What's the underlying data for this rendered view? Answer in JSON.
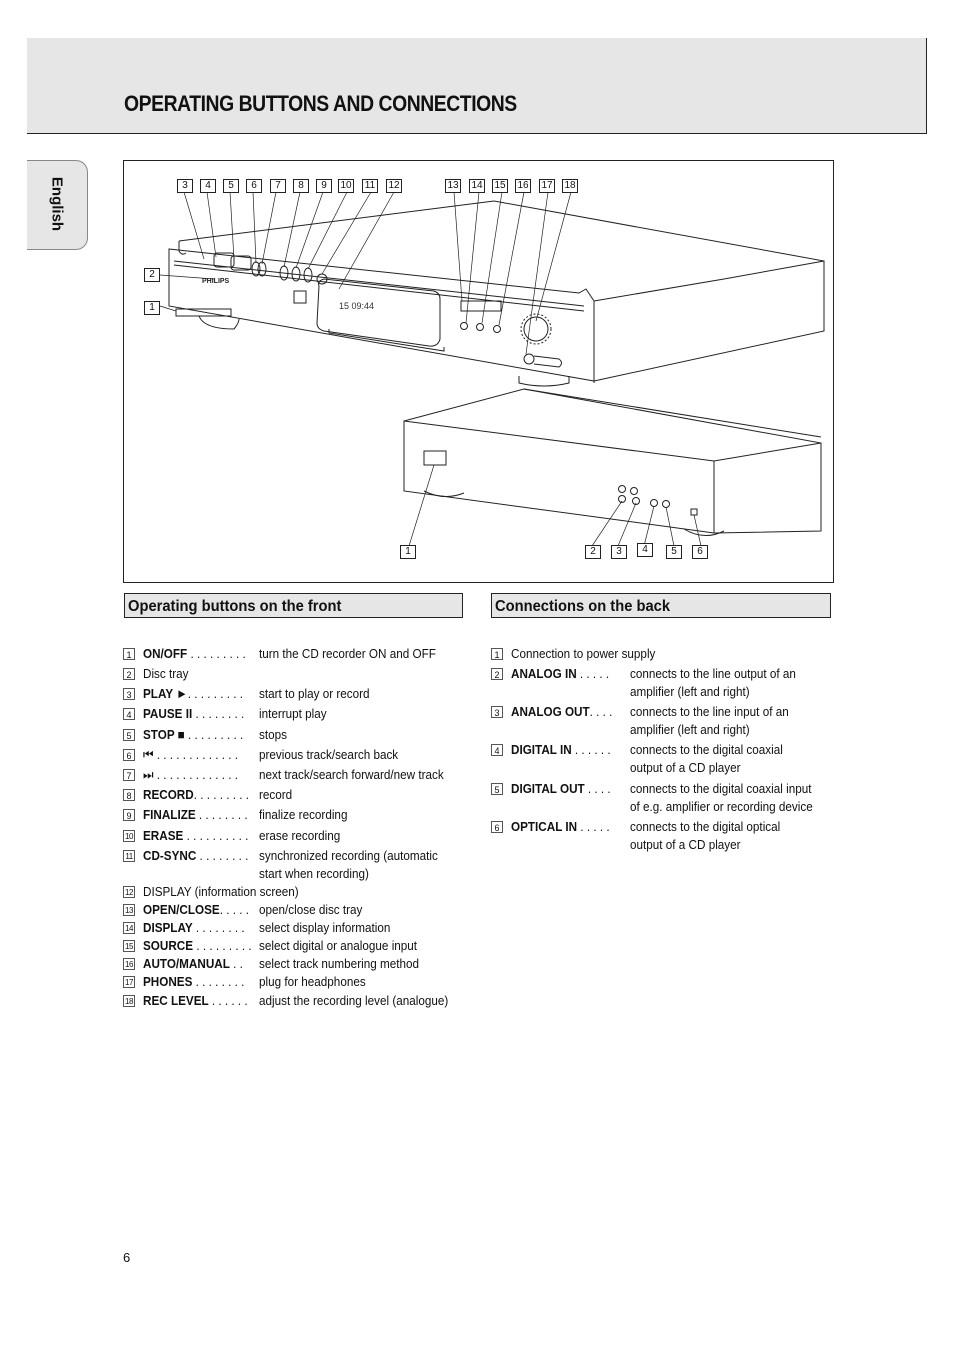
{
  "page": {
    "title": "OPERATING BUTTONS AND CONNECTIONS",
    "language_tab": "English",
    "page_number": "6"
  },
  "figure": {
    "brand": "PHILIPS",
    "display_readout": "15  09:44",
    "front_callouts": [
      "1",
      "2",
      "3",
      "4",
      "5",
      "6",
      "7",
      "8",
      "9",
      "10",
      "11",
      "12",
      "13",
      "14",
      "15",
      "16",
      "17",
      "18"
    ],
    "back_callouts": [
      "1",
      "2",
      "3",
      "4",
      "5",
      "6"
    ]
  },
  "front": {
    "heading": "Operating buttons on the front",
    "items": [
      {
        "num": "1",
        "label": "ON/OFF",
        "bold": true,
        "dots": " . . . . . . . . .",
        "desc": "turn the CD recorder ON and OFF"
      },
      {
        "num": "2",
        "label": "Disc tray",
        "bold": false,
        "dots": "",
        "desc": ""
      },
      {
        "num": "3",
        "label": "PLAY  ►",
        "bold": true,
        "dots": ". . . . . . . . .",
        "desc": "start to play or record"
      },
      {
        "num": "4",
        "label": "PAUSE II",
        "bold": true,
        "dots": " . . . . . . . .",
        "desc": "interrupt play"
      },
      {
        "num": "5",
        "label": "STOP ■",
        "bold": true,
        "dots": " . . . . . . . . .",
        "desc": "stops"
      },
      {
        "num": "6",
        "label": "⏮",
        "bold": false,
        "dots": " . . . . . . . . . . . . .",
        "desc": "previous track/search back"
      },
      {
        "num": "7",
        "label": "⏭",
        "bold": false,
        "dots": " . . . . . . . . . . . . .",
        "desc": "next track/search forward/new track"
      },
      {
        "num": "8",
        "label": "RECORD",
        "bold": true,
        "dots": ". . . . . . . . .",
        "desc": "record"
      },
      {
        "num": "9",
        "label": "FINALIZE",
        "bold": true,
        "dots": " . . . . . . . .",
        "desc": "finalize recording"
      },
      {
        "num": "10",
        "label": "ERASE",
        "bold": true,
        "dots": " . . . . . . . . . .",
        "desc": "erase recording"
      },
      {
        "num": "11",
        "label": "CD-SYNC",
        "bold": true,
        "dots": " . . . . . . . .",
        "desc": "synchronized recording (automatic",
        "desc2": "start when recording)"
      },
      {
        "num": "12",
        "label": "DISPLAY (information screen)",
        "bold": false,
        "dots": "",
        "desc": ""
      },
      {
        "num": "13",
        "label": "OPEN/CLOSE",
        "bold": true,
        "dots": ". . . . .",
        "desc": "open/close disc tray"
      },
      {
        "num": "14",
        "label": "DISPLAY",
        "bold": true,
        "dots": " . . . . . . . .",
        "desc": "select display information"
      },
      {
        "num": "15",
        "label": "SOURCE",
        "bold": true,
        "dots": " . . . . . . . . .",
        "desc": "select digital or analogue input"
      },
      {
        "num": "16",
        "label": "AUTO/MANUAL",
        "bold": true,
        "dots": " . .",
        "desc": "select track numbering method"
      },
      {
        "num": "17",
        "label": "PHONES",
        "bold": true,
        "dots": " . . . . . . . .",
        "desc": "plug for headphones"
      },
      {
        "num": "18",
        "label": "REC LEVEL",
        "bold": true,
        "dots": " . . . . . .",
        "desc": "adjust the recording level (analogue)"
      }
    ]
  },
  "back": {
    "heading": "Connections on the back",
    "items": [
      {
        "num": "1",
        "label": "Connection to power supply",
        "bold": false,
        "dots": "",
        "desc": ""
      },
      {
        "num": "2",
        "label": "ANALOG IN",
        "bold": true,
        "dots": " . . . . .",
        "desc": "connects to the line output of an",
        "desc2": "amplifier (left and right)"
      },
      {
        "num": "3",
        "label": "ANALOG OUT",
        "bold": true,
        "dots": ". . . .",
        "desc": "connects to the line input of an",
        "desc2": "amplifier (left and right)"
      },
      {
        "num": "4",
        "label": "DIGITAL IN",
        "bold": true,
        "dots": " . . . . . .",
        "desc": "connects to the digital coaxial",
        "desc2": "output of a CD player"
      },
      {
        "num": "5",
        "label": "DIGITAL OUT",
        "bold": true,
        "dots": " . . . .",
        "desc": "connects to the digital coaxial input",
        "desc2": "of e.g. amplifier or recording device"
      },
      {
        "num": "6",
        "label": "OPTICAL IN",
        "bold": true,
        "dots": " . . . . .",
        "desc": "connects to the digital optical",
        "desc2": "output of a CD player"
      }
    ]
  }
}
